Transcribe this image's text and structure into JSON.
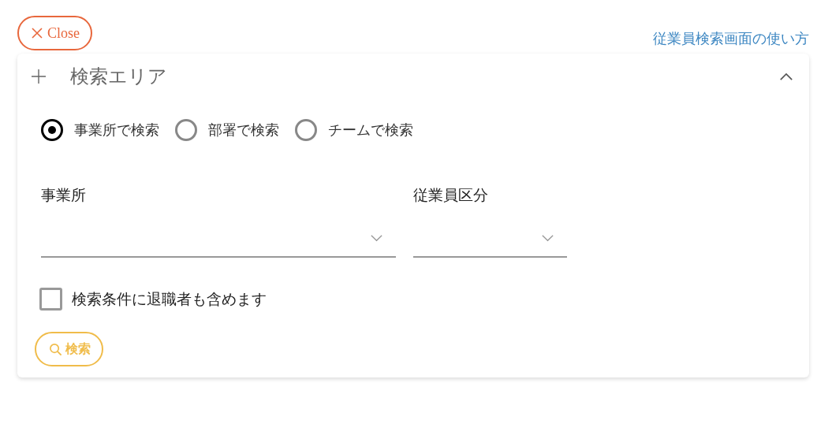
{
  "close_button": {
    "label": "Close"
  },
  "help_link": {
    "label": "従業員検索画面の使い方"
  },
  "panel": {
    "title": "検索エリア",
    "expanded": true
  },
  "radios": [
    {
      "label": "事業所で検索",
      "selected": true
    },
    {
      "label": "部署で検索",
      "selected": false
    },
    {
      "label": "チームで検索",
      "selected": false
    }
  ],
  "fields": [
    {
      "label": "事業所",
      "kind": "wide"
    },
    {
      "label": "従業員区分",
      "kind": "narrow"
    }
  ],
  "checkbox": {
    "label": "検索条件に退職者も含めます",
    "checked": false
  },
  "search_button": {
    "label": "検索"
  }
}
